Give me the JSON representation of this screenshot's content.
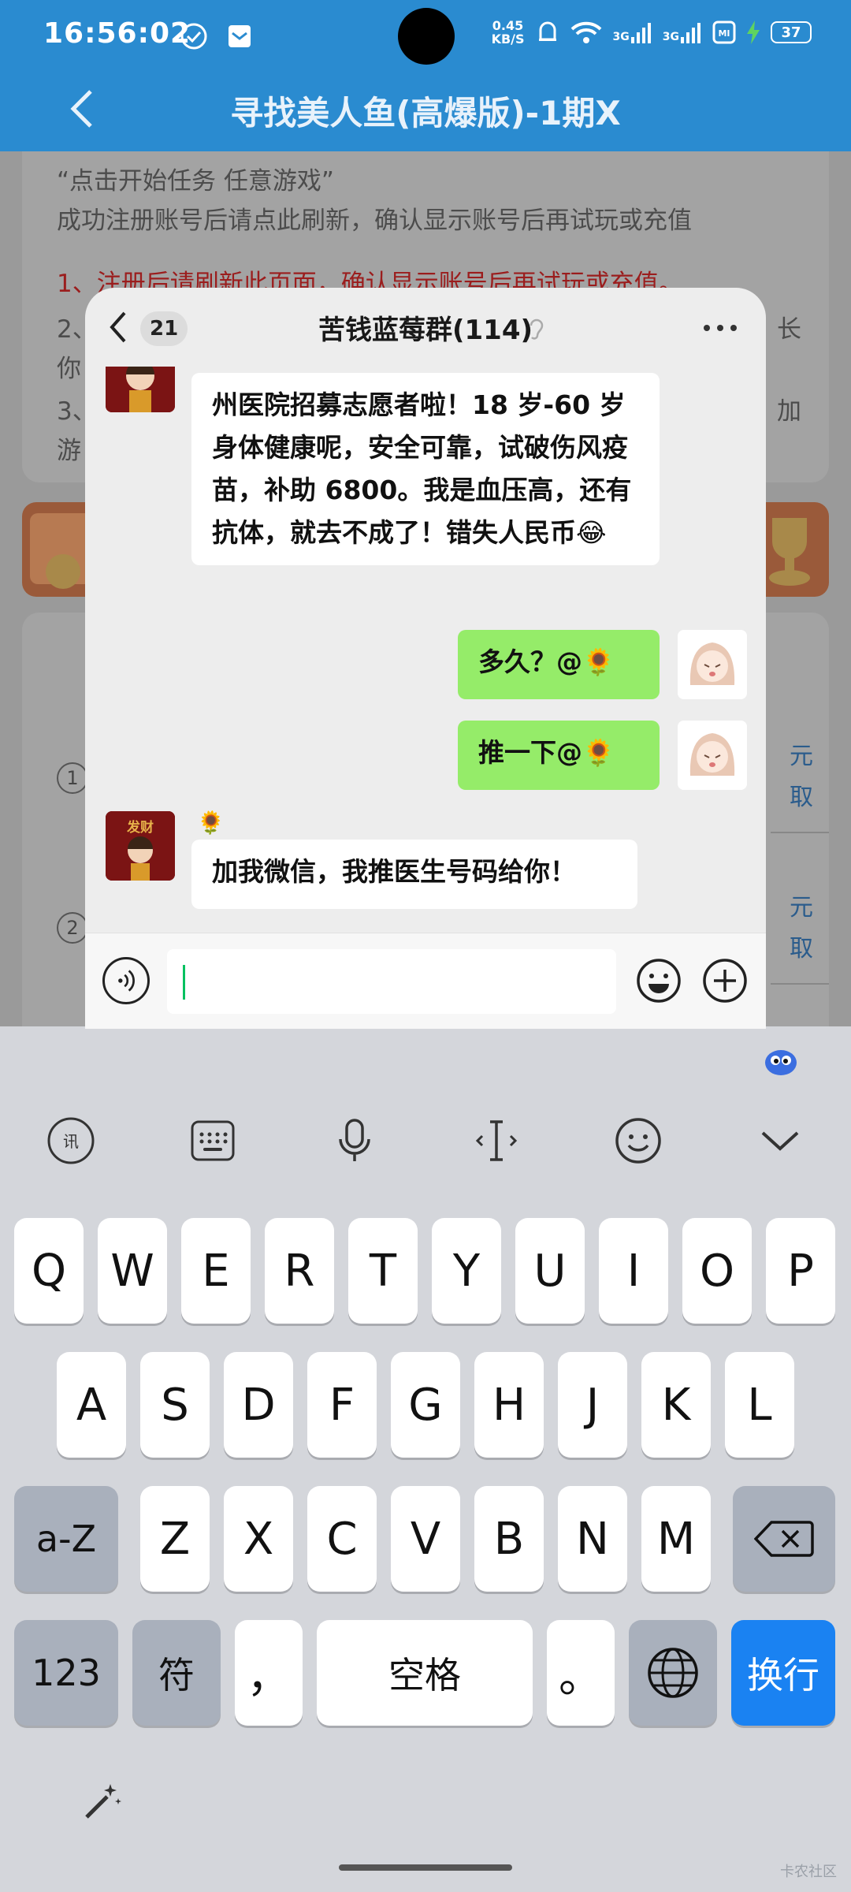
{
  "status_bar": {
    "time": "16:56:02",
    "net_speed_value": "0.45",
    "net_speed_unit": "KB/S",
    "signal1": "3G",
    "signal2": "3G",
    "battery": "37"
  },
  "header": {
    "title": "寻找美人鱼(高爆版)-1期X"
  },
  "background_page": {
    "lines": [
      "“点击开始任务 任意游戏”",
      "成功注册账号后请点此刷新，确认显示账号后再试玩或充值",
      "1、注册后请刷新此页面，确认显示账号后再试玩或充值。",
      "2、",
      "你",
      "3、",
      "游"
    ],
    "line_right_2": "长",
    "line_right_3": "加",
    "items": [
      {
        "num": "1",
        "right_top": "元",
        "right_bottom": "取"
      },
      {
        "num": "2",
        "right_top": "元",
        "right_bottom": "取"
      }
    ]
  },
  "chat": {
    "unread_badge": "21",
    "title": "苦钱蓝莓群(114)",
    "messages": [
      {
        "side": "left",
        "text": "州医院招募志愿者啦！18 岁-60 岁身体健康呢，安全可靠，试破伤风疫苗，补助 6800。我是血压高，还有抗体，就去不成了！错失人民币😂"
      },
      {
        "side": "right",
        "text": "多久？@🌻"
      },
      {
        "side": "right",
        "text": "推一下@🌻"
      },
      {
        "side": "left",
        "sender": "🌻",
        "avatar_text": "发财",
        "text": "加我微信，我推医生号码给你！"
      }
    ],
    "input": {
      "value": ""
    }
  },
  "keyboard": {
    "row1": [
      "Q",
      "W",
      "E",
      "R",
      "T",
      "Y",
      "U",
      "I",
      "O",
      "P"
    ],
    "row2": [
      "A",
      "S",
      "D",
      "F",
      "G",
      "H",
      "J",
      "K",
      "L"
    ],
    "row3": [
      "Z",
      "X",
      "C",
      "V",
      "B",
      "N",
      "M"
    ],
    "case_key": "a-Z",
    "numbers_key": "123",
    "symbols_key": "符",
    "comma_key": "，",
    "space_key": "空格",
    "period_key": "。",
    "enter_key": "换行",
    "toolbar_icons": [
      "voice-input-icon",
      "keyboard-layout-icon",
      "microphone-icon",
      "cursor-icon",
      "emoji-icon",
      "collapse-icon"
    ]
  },
  "watermark": "卡农社区",
  "colors": {
    "app_blue": "#2a8bd0",
    "my_bubble": "#95ec69",
    "enter_key": "#1a82f2",
    "cursor": "#07c160"
  }
}
